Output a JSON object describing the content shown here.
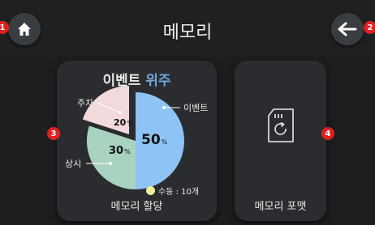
{
  "header": {
    "title": "메모리"
  },
  "markers": [
    "1",
    "2",
    "3",
    "4"
  ],
  "icons": {
    "home": "home-icon",
    "back": "back-arrow-icon",
    "format": "sd-card-refresh-icon"
  },
  "memory_card": {
    "title_part1": "이벤트",
    "title_part2": "위주",
    "label": "메모리 할당",
    "legend": "수동 : 10개",
    "unit": "%",
    "slices": [
      {
        "name": "이벤트",
        "percent": 50,
        "color": "#8ec3f5"
      },
      {
        "name": "상시",
        "percent": 30,
        "color": "#a7d3c0"
      },
      {
        "name": "주차",
        "percent": 20,
        "color": "#f1d9dc"
      }
    ],
    "legend_color": "#eaf2a0"
  },
  "format_card": {
    "label": "메모리 포맷"
  },
  "colors": {
    "accent": "#6fa7d8",
    "marker": "#e02020",
    "background": "#1c1e20"
  }
}
